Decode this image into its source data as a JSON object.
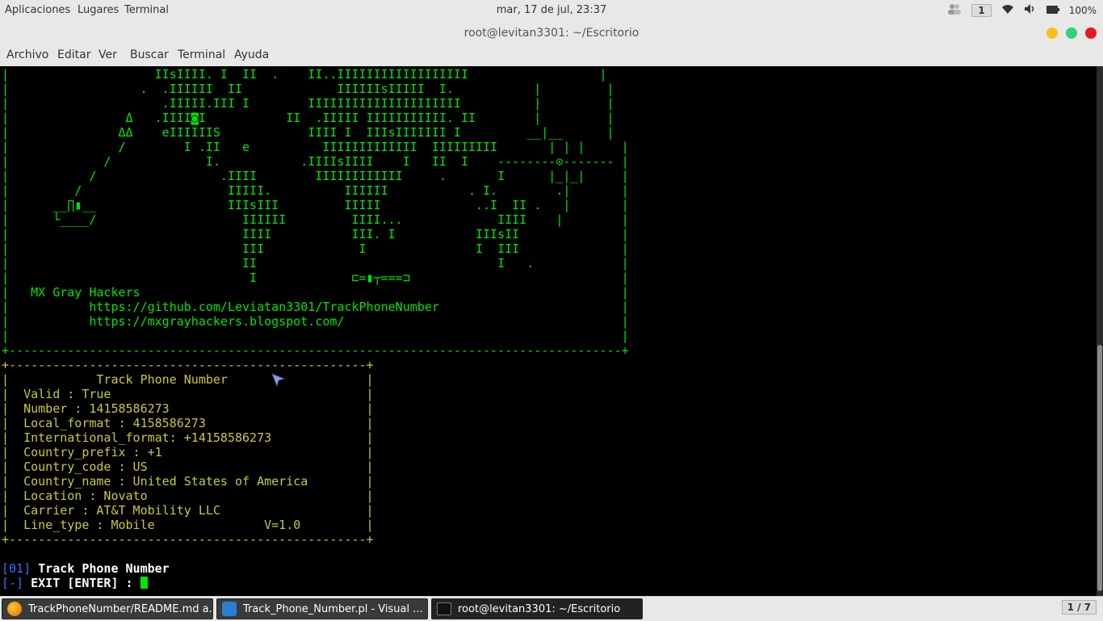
{
  "topbar": {
    "apps": "Aplicaciones",
    "places": "Lugares",
    "terminal": "Terminal",
    "clock": "mar, 17 de jul, 23:37",
    "workspace": "1",
    "battery": "100%"
  },
  "window": {
    "title": "root@levitan3301: ~/Escritorio"
  },
  "menu": [
    "Archivo",
    "Editar",
    "Ver",
    "Buscar",
    "Terminal",
    "Ayuda"
  ],
  "terminal": {
    "banner": "|                    IIsIIII. I  II  .    II..IIIIIIIIIIIIIIIIII                  |\n|                  .  .IIIIII  II             IIIIIIsIIIII  I.           |         |\n|                     .IIIII.III I        IIIIIIIIIIIIIIIIIIIII          |         |\n|                Δ   .IIII◙I           II  .IIIII IIIIIIIIIII. II        |         |\n|               ΔΔ    eIIIIIIS            IIII I  IIIsIIIIIII I         __|__      |\n|               /        I .II   e          IIIIIIIIIIIII  IIIIIIIII       | | |     |\n|             /             I.           .IIIIsIIII    I   II  I    --------⊙------- |\n|           /                 .IIII        IIIIIIIIIIII     .       I      |_|_|     |\n|         /                    IIIII.          IIIIII           . I.        .|       |\n|      __∏▮__                  IIIsIII         IIIII             ..I  II .   |       |\n|      └____/                    IIIIII         IIII...             IIII    |        |\n|                                IIII           III. I           IIIsII              |\n|                                III             I               I  III              |\n|                                II                                 I   .            |\n|                                 I             ⊏=▮┬===⊐                             |\n|   MX Gray Hackers                                                                  |\n|           https://github.com/Leviatan3301/TrackPhoneNumber                         |\n|           https://mxgrayhackers.blogspot.com/                                      |\n|                                                                                    |\n+------------------------------------------------------------------------------------+",
    "info_box": "+-------------------------------------------------+\n|            Track Phone Number                   |\n|  Valid : True                                   |\n|  Number : 14158586273                           |\n|  Local_format : 4158586273                      |\n|  International_format: +14158586273             |\n|  Country_prefix : +1                            |\n|  Country_code : US                              |\n|  Country_name : United States of America        |\n|  Location : Novato                              |\n|  Carrier : AT&T Mobility LLC                    |\n|  Line_type : Mobile               V=1.0         |\n+-------------------------------------------------+",
    "opt1_tag": "[01]",
    "opt1_label": " Track Phone Number",
    "opt2_tag": "[-]",
    "opt2_label": " EXIT [ENTER] : "
  },
  "taskbar": {
    "tasks": [
      "TrackPhoneNumber/README.md a...",
      "Track_Phone_Number.pl - Visual ...",
      "root@levitan3301: ~/Escritorio"
    ],
    "pager": "1 / 7"
  }
}
